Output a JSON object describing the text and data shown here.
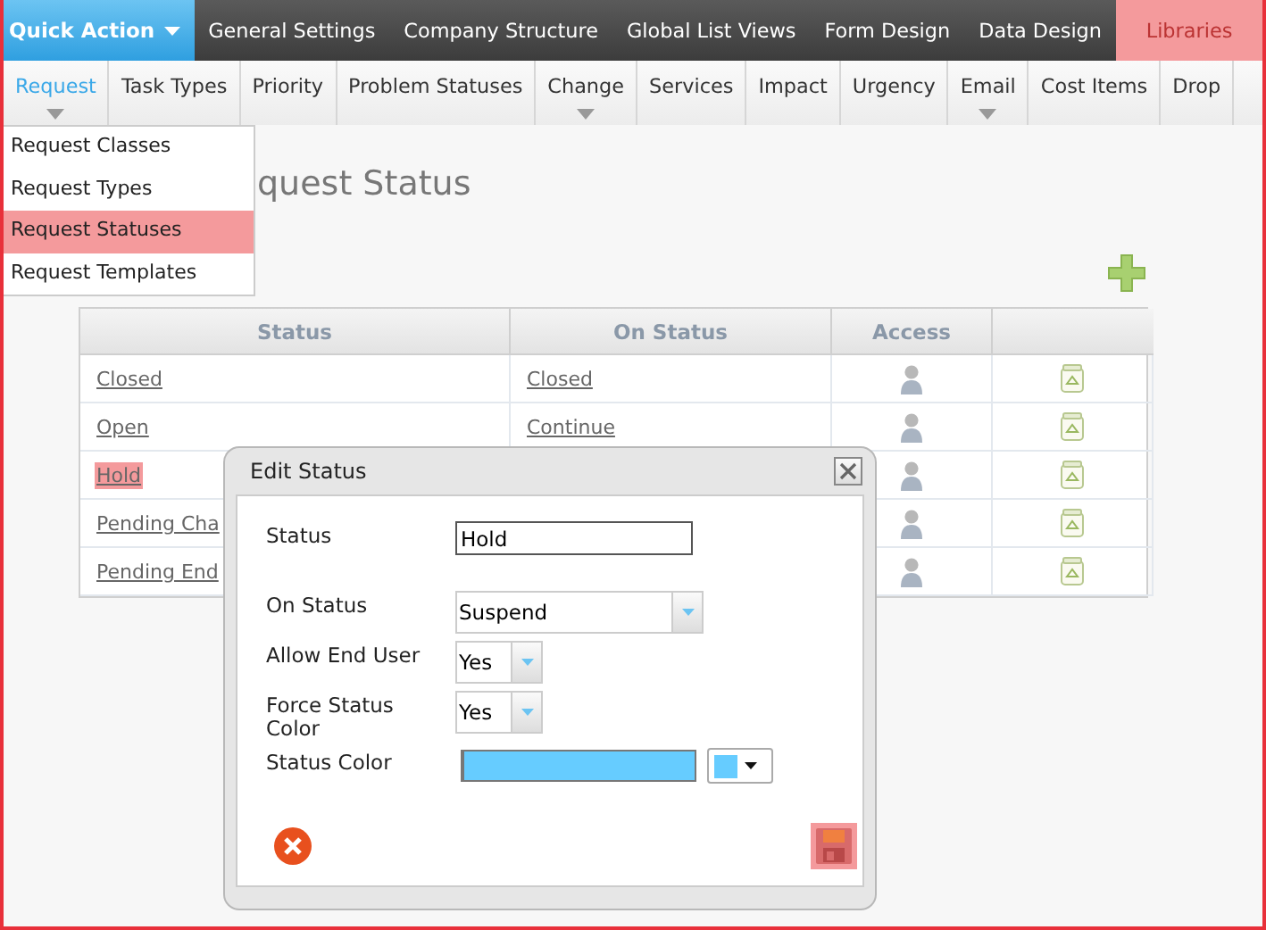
{
  "quick_action": {
    "label": "Quick Action"
  },
  "top_nav": [
    {
      "label": "General Settings",
      "selected": false
    },
    {
      "label": "Company Structure",
      "selected": false
    },
    {
      "label": "Global List Views",
      "selected": false
    },
    {
      "label": "Form Design",
      "selected": false
    },
    {
      "label": "Data Design",
      "selected": false
    },
    {
      "label": "Libraries",
      "selected": true
    }
  ],
  "sub_nav": [
    {
      "label": "Request",
      "selected": true,
      "has_menu": true
    },
    {
      "label": "Task Types",
      "selected": false,
      "has_menu": false
    },
    {
      "label": "Priority",
      "selected": false,
      "has_menu": false
    },
    {
      "label": "Problem Statuses",
      "selected": false,
      "has_menu": false
    },
    {
      "label": "Change",
      "selected": false,
      "has_menu": true
    },
    {
      "label": "Services",
      "selected": false,
      "has_menu": false
    },
    {
      "label": "Impact",
      "selected": false,
      "has_menu": false
    },
    {
      "label": "Urgency",
      "selected": false,
      "has_menu": false
    },
    {
      "label": "Email",
      "selected": false,
      "has_menu": true
    },
    {
      "label": "Cost Items",
      "selected": false,
      "has_menu": false
    },
    {
      "label": "Drop",
      "selected": false,
      "has_menu": false
    }
  ],
  "dropdown": {
    "items": [
      {
        "label": "Request Classes",
        "selected": false
      },
      {
        "label": "Request Types",
        "selected": false
      },
      {
        "label": "Request Statuses",
        "selected": true
      },
      {
        "label": "Request Templates",
        "selected": false
      }
    ]
  },
  "page_title": "quest Status",
  "table": {
    "columns": [
      "Status",
      "On Status",
      "Access"
    ],
    "rows": [
      {
        "status": "Closed",
        "on_status": "Closed",
        "selected": false
      },
      {
        "status": "Open",
        "on_status": "Continue",
        "selected": false
      },
      {
        "status": "Hold",
        "selected": true
      },
      {
        "status": "Pending Cha",
        "selected": false
      },
      {
        "status": "Pending End",
        "selected": false
      }
    ]
  },
  "dialog": {
    "title": "Edit Status",
    "fields": [
      {
        "kind": "text",
        "label": "Status",
        "value": "Hold"
      },
      {
        "kind": "select",
        "label": "On Status",
        "value": "Suspend"
      },
      {
        "kind": "select",
        "label": "Allow End User",
        "value": "Yes"
      },
      {
        "kind": "select",
        "label": "Force Status Color",
        "value": "Yes"
      },
      {
        "kind": "color",
        "label": "Status Color",
        "color": "#66ccff"
      }
    ]
  }
}
